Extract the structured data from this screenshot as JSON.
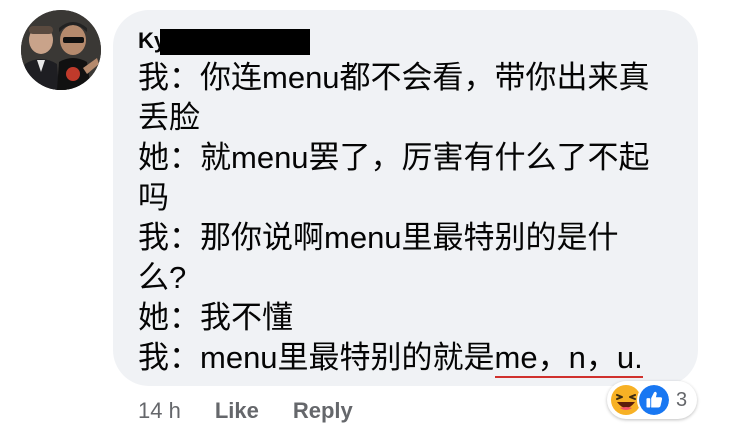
{
  "comment": {
    "author_prefix": "Ky",
    "lines": [
      "我：你连menu都不会看，带你出来真",
      "丢脸",
      "她：就menu罢了，厉害有什么了不起",
      "吗",
      "我：那你说啊menu里最特别的是什",
      "么?",
      "她：我不懂"
    ],
    "last_line_prefix": "我：menu里最特别的就是",
    "last_line_highlight": "me，n，u.",
    "underline_color": "#d0312d"
  },
  "meta": {
    "time": "14 h",
    "like_label": "Like",
    "reply_label": "Reply"
  },
  "reactions": {
    "icons": [
      "laughing-emoji",
      "thumbs-up-like"
    ],
    "count": "3",
    "like_color": "#1877f2",
    "laugh_color": "#f7b125"
  },
  "colors": {
    "bubble_bg": "#f0f2f5",
    "text": "#050505",
    "meta_text": "#65676b"
  }
}
